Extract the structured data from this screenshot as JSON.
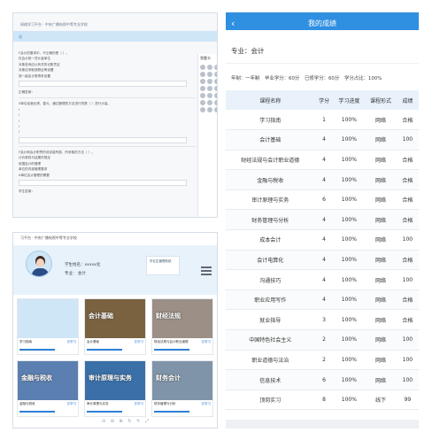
{
  "exam": {
    "crumb": "网络学习平台 · 中央广播电视中等专业学校",
    "band_label": "试",
    "panel_title": "答题卡",
    "questions": [
      "F会计的要求中，不正确的是（ ）。",
      "在会计核一些计量单位",
      "对象查询应以有关的记账凭证",
      "对象应采取按照证等设置",
      "按一级会计账簿来设置",
      "5单位经营业绩、盈亏，通过管理的方法进行的是（ ）进行计量。",
      "F会计和会计职责的设定能所属，所采取的方法（ ）。",
      "计价原则与结果的规定",
      "依据会计的管理",
      "单位的内部管理要求",
      "A单位会计管理的需要"
    ],
    "answer_label": "正确答案：",
    "student_label": "学生答案："
  },
  "portal": {
    "topbar": "习平台  · 中央广播电视中等专业学校",
    "student_name": "学生姓名：xxxxx化",
    "major": "专业：  会计",
    "badge": "毕业生管理系统",
    "pager": "⊙ ⊖ ⊕ ↻ ✎ ⤢",
    "cards": [
      {
        "name": "学习指南",
        "caption": "",
        "go": "去学习",
        "color": "#cfe6f7"
      },
      {
        "name": "会计基础",
        "caption": "会计基础",
        "go": "去学习",
        "color": "#7a6240"
      },
      {
        "name": "财经法规与会计职业道德",
        "caption": "财经法规",
        "go": "去学习",
        "color": "#9b8f86"
      },
      {
        "name": "金融与税收",
        "caption": "金融与税收",
        "go": "去学习",
        "color": "#5b7fb0"
      },
      {
        "name": "审计原理与实务",
        "caption": "审计原理与实务",
        "go": "去学习",
        "color": "#3a6fa8"
      },
      {
        "name": "财务管理与分析",
        "caption": "财务会计",
        "go": "去学习",
        "color": "#7f94a8"
      }
    ],
    "progress": 1.0
  },
  "app": {
    "title": "我的成绩",
    "back_icon": "back-arrow-icon",
    "major": "专业：会计",
    "summary": {
      "years": "年制：一年制",
      "required": "毕业学分：60分",
      "earned": "已修学分：60分",
      "ratio": "学分占比：100%"
    },
    "headers": [
      "课程名称",
      "学分",
      "学习进度",
      "课程形式",
      "成绩"
    ],
    "rows": [
      [
        "学习指南",
        "1",
        "100%",
        "网络",
        "合格"
      ],
      [
        "会计基础",
        "4",
        "100%",
        "网络",
        "100"
      ],
      [
        "财经法规与会计职业道德",
        "4",
        "100%",
        "网络",
        "合格"
      ],
      [
        "金融与税收",
        "4",
        "100%",
        "网络",
        "合格"
      ],
      [
        "审计原理与实务",
        "6",
        "100%",
        "网络",
        "合格"
      ],
      [
        "财务管理与分析",
        "4",
        "100%",
        "网络",
        "合格"
      ],
      [
        "成本会计",
        "4",
        "100%",
        "网络",
        "100"
      ],
      [
        "会计电算化",
        "4",
        "100%",
        "网络",
        "合格"
      ],
      [
        "沟通技巧",
        "4",
        "100%",
        "网络",
        "100"
      ],
      [
        "职业应用写作",
        "4",
        "100%",
        "网络",
        "合格"
      ],
      [
        "就业指导",
        "3",
        "100%",
        "网络",
        "合格"
      ],
      [
        "中国特色社会主义",
        "2",
        "100%",
        "网络",
        "100"
      ],
      [
        "职业道德与法治",
        "2",
        "100%",
        "网络",
        "100"
      ],
      [
        "信息技术",
        "6",
        "100%",
        "网络",
        "100"
      ],
      [
        "顶岗实习",
        "8",
        "100%",
        "线下",
        "99"
      ]
    ],
    "accent": "#2f8fe0"
  }
}
